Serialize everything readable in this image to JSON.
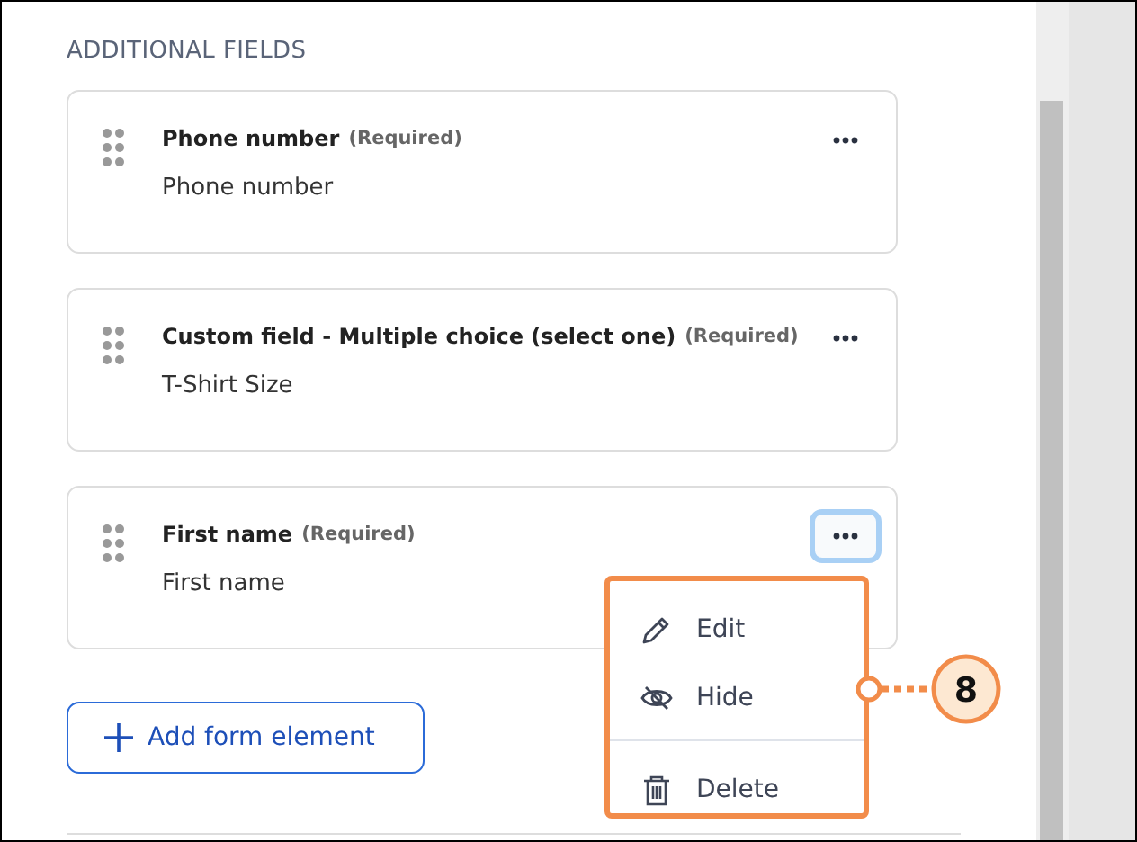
{
  "section_title": "ADDITIONAL FIELDS",
  "fields": [
    {
      "label": "Phone number",
      "note": "(Required)",
      "value": "Phone number",
      "menu_open": false
    },
    {
      "label": "Custom field - Multiple choice (select one)",
      "note": "(Required)",
      "value": "T-Shirt Size",
      "menu_open": false
    },
    {
      "label": "First name",
      "note": "(Required)",
      "value": "First name",
      "menu_open": true
    }
  ],
  "add_button": {
    "label": "Add form element"
  },
  "menu": {
    "items": [
      {
        "kind": "edit",
        "label": "Edit"
      },
      {
        "kind": "hide",
        "label": "Hide"
      },
      {
        "kind": "delete",
        "label": "Delete"
      }
    ]
  },
  "callout": {
    "number": "8"
  }
}
